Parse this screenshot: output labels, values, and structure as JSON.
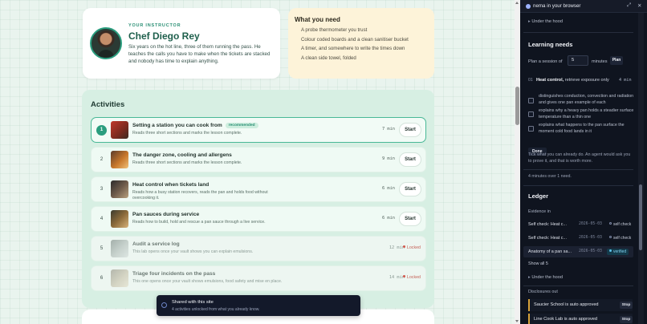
{
  "instructor": {
    "eyebrow": "YOUR INSTRUCTOR",
    "name": "Chef Diego Rey",
    "bio": "Six years on the hot line, three of them running the pass. He teaches the calls you have to make when the tickets are stacked and nobody has time to explain anything."
  },
  "needs": {
    "title": "What you need",
    "items": [
      "A probe thermometer you trust",
      "Colour coded boards and a clean sanitiser bucket",
      "A timer, and somewhere to write the times down",
      "A clean side towel, folded"
    ]
  },
  "activities": {
    "title": "Activities",
    "start_label": "Start",
    "locked_label": "Locked",
    "recommended_label": "recommended",
    "items": [
      {
        "num": "1",
        "name": "Setting a station you can cook from",
        "desc": "Reads three short sections and marks the lesson complete.",
        "duration": "7 min",
        "state": "active"
      },
      {
        "num": "2",
        "name": "The danger zone, cooling and allergens",
        "desc": "Reads three short sections and marks the lesson complete.",
        "duration": "9 min",
        "state": "open"
      },
      {
        "num": "3",
        "name": "Heat control when tickets land",
        "desc": "Reads how a busy station recovers, reads the pan and holds food without overcooking it.",
        "duration": "6 min",
        "state": "open"
      },
      {
        "num": "4",
        "name": "Pan sauces during service",
        "desc": "Reads how to build, hold and rescue a pan sauce through a live service.",
        "duration": "6 min",
        "state": "open"
      },
      {
        "num": "5",
        "name": "Audit a service log",
        "desc": "This lab opens once your vault shows you can explain emulsions.",
        "duration": "12 min",
        "state": "locked"
      },
      {
        "num": "6",
        "name": "Triage four incidents on the pass",
        "desc": "This one opens once your vault shows emulsions, food safety and mise en place.",
        "duration": "14 min",
        "state": "locked"
      }
    ]
  },
  "toast": {
    "title": "Shared with this site",
    "subtitle": "4 activities unlocked from what you already know."
  },
  "panel": {
    "title": "nema in your browser",
    "under_hood": "Under the hood",
    "learning_needs": {
      "title": "Learning needs",
      "plan_prefix": "Plan a session of",
      "plan_value": "5",
      "plan_suffix": "minutes",
      "plan_button": "Plan",
      "objective_num": "01",
      "objective_bold": "Heat control,",
      "objective_rest": " retrieve exposure only",
      "objective_duration": "4 min",
      "checks": [
        "distinguishes conduction, convection and radiation and gives one pan example of each",
        "explains why a heavy pan holds a steadier surface temperature than a thin one",
        "explains what happens to the pan surface the moment cold food lands in it"
      ],
      "done_button": "Done",
      "tick_note": "Tick what you can already do. An agent would ask you to prove it, and that is worth more.",
      "covered": "4 minutes over 1 need."
    },
    "ledger": {
      "title": "Ledger",
      "evidence_label": "Evidence in",
      "evidence": [
        {
          "name": "Self check: Heat c...",
          "date": "2026-05-03",
          "tag": "self check",
          "kind": "self"
        },
        {
          "name": "Self check: Heat c...",
          "date": "2026-05-03",
          "tag": "self check",
          "kind": "self"
        },
        {
          "name": "Anatomy of a pan sa...",
          "date": "2026-05-03",
          "tag": "verified",
          "kind": "verified"
        }
      ],
      "show_all": "Show all 5"
    },
    "disclosures": {
      "title": "Disclosures out",
      "items": [
        {
          "text": "Saucier School is auto approved",
          "button": "Stop"
        },
        {
          "text": "Line Cook Lab is auto approved",
          "button": "Stop"
        }
      ]
    }
  },
  "colors": {
    "accent": "#2a9d7e",
    "needs_bg": "#fdf3d9",
    "activities_bg": "#d7efe3",
    "panel_bg": "#0f141f",
    "locked": "#d1574c",
    "disclosure_bar": "#d7a23a"
  }
}
